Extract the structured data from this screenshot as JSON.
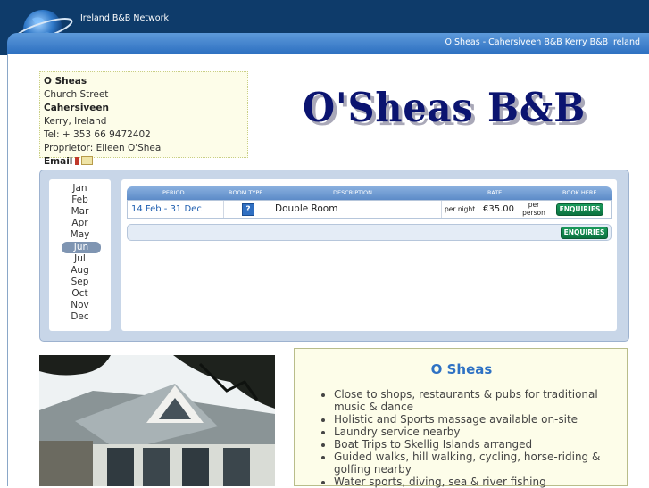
{
  "header": {
    "network_label": "Ireland B&B Network",
    "tab_title": "O Sheas - Cahersiveen B&B Kerry B&B Ireland"
  },
  "address": {
    "name": "O Sheas",
    "street": "Church Street",
    "town": "Cahersiveen",
    "region": "Kerry, Ireland",
    "tel": "Tel: + 353 66 9472402",
    "proprietor": "Proprietor: Eileen O'Shea",
    "email_label": "Email"
  },
  "logo": {
    "text": "O'Sheas B&B"
  },
  "months": {
    "items": [
      "Jan",
      "Feb",
      "Mar",
      "Apr",
      "May",
      "Jun",
      "Jul",
      "Aug",
      "Sep",
      "Oct",
      "Nov",
      "Dec"
    ],
    "selected": "Jun"
  },
  "rates": {
    "headers": {
      "period": "PERIOD",
      "room_type": "ROOM TYPE",
      "description": "DESCRIPTION",
      "rate": "RATE",
      "book": "BOOK HERE"
    },
    "rows": [
      {
        "period": "14 Feb - 31 Dec",
        "room_type_icon": "?",
        "description": "Double Room",
        "per": "per night",
        "price": "€35.00",
        "unit_top": "per",
        "unit_bottom": "person",
        "button": "ENQUIRIES"
      }
    ],
    "footer_button": "ENQUIRIES"
  },
  "info": {
    "title": "O Sheas",
    "features": [
      "Close to shops, restaurants & pubs for traditional music & dance",
      "Holistic and Sports massage available on-site",
      "Laundry service nearby",
      "Boat Trips to Skellig Islands arranged",
      "Guided walks, hill walking, cycling, horse-riding & golfing nearby",
      "Water sports, diving, sea & river fishing"
    ]
  },
  "colors": {
    "header_bg": "#0e3b6a",
    "tab_blue": "#3f7fcc",
    "logo_navy": "#0b1470",
    "enquiry_green": "#0b7240",
    "info_title": "#2f72c4"
  }
}
